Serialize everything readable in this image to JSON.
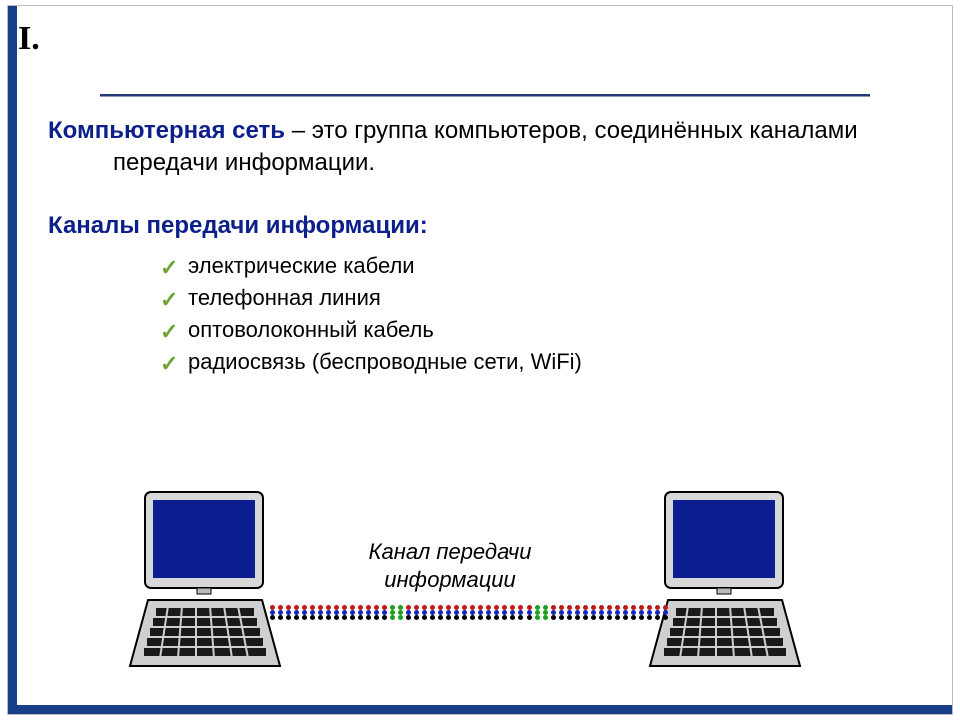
{
  "slide": {
    "number": "I.",
    "definition": {
      "term": "Компьютерная сеть",
      "text": " – это группа компьютеров, соединённых каналами передачи информации."
    },
    "channels": {
      "heading": "Каналы передачи информации:",
      "items": [
        "электрические кабели",
        "телефонная линия",
        "оптоволоконный кабель",
        "радиосвязь (беспроводные сети, WiFi)"
      ]
    },
    "diagram": {
      "caption_line1": "Канал передачи",
      "caption_line2": "информации"
    }
  }
}
